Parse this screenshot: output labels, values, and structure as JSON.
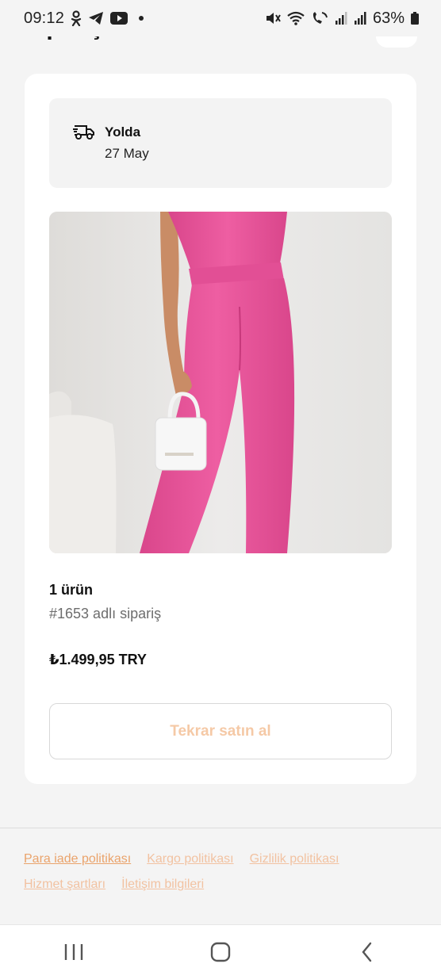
{
  "status_bar": {
    "time": "09:12",
    "battery": "63%",
    "left_icons": [
      "odnoklassniki-icon",
      "telegram-icon",
      "youtube-icon",
      "notification-dot-icon"
    ],
    "right_icons": [
      "mute-icon",
      "wifi-icon",
      "wifi-calling-icon",
      "signal-icon",
      "signal-icon",
      "battery-icon"
    ]
  },
  "header": {
    "title_partial": "Siparişler"
  },
  "order": {
    "status": "Yolda",
    "date": "27 May",
    "item_count": "1 ürün",
    "order_number": "#1653 adlı sipariş",
    "total": "₺1.499,95 TRY",
    "rebuy_label": "Tekrar satın al",
    "image": "pink-jumpsuit-product-photo"
  },
  "footer": {
    "links": [
      {
        "label": "Para iade politikası"
      },
      {
        "label": "Kargo politikası"
      },
      {
        "label": "Gizlilik politikası"
      },
      {
        "label": "Hizmet şartları"
      },
      {
        "label": "İletişim bilgileri"
      }
    ]
  },
  "colors": {
    "accent": "#eaa36b",
    "accent_light": "#f2c2a1",
    "product_pink": "#e9559a"
  }
}
